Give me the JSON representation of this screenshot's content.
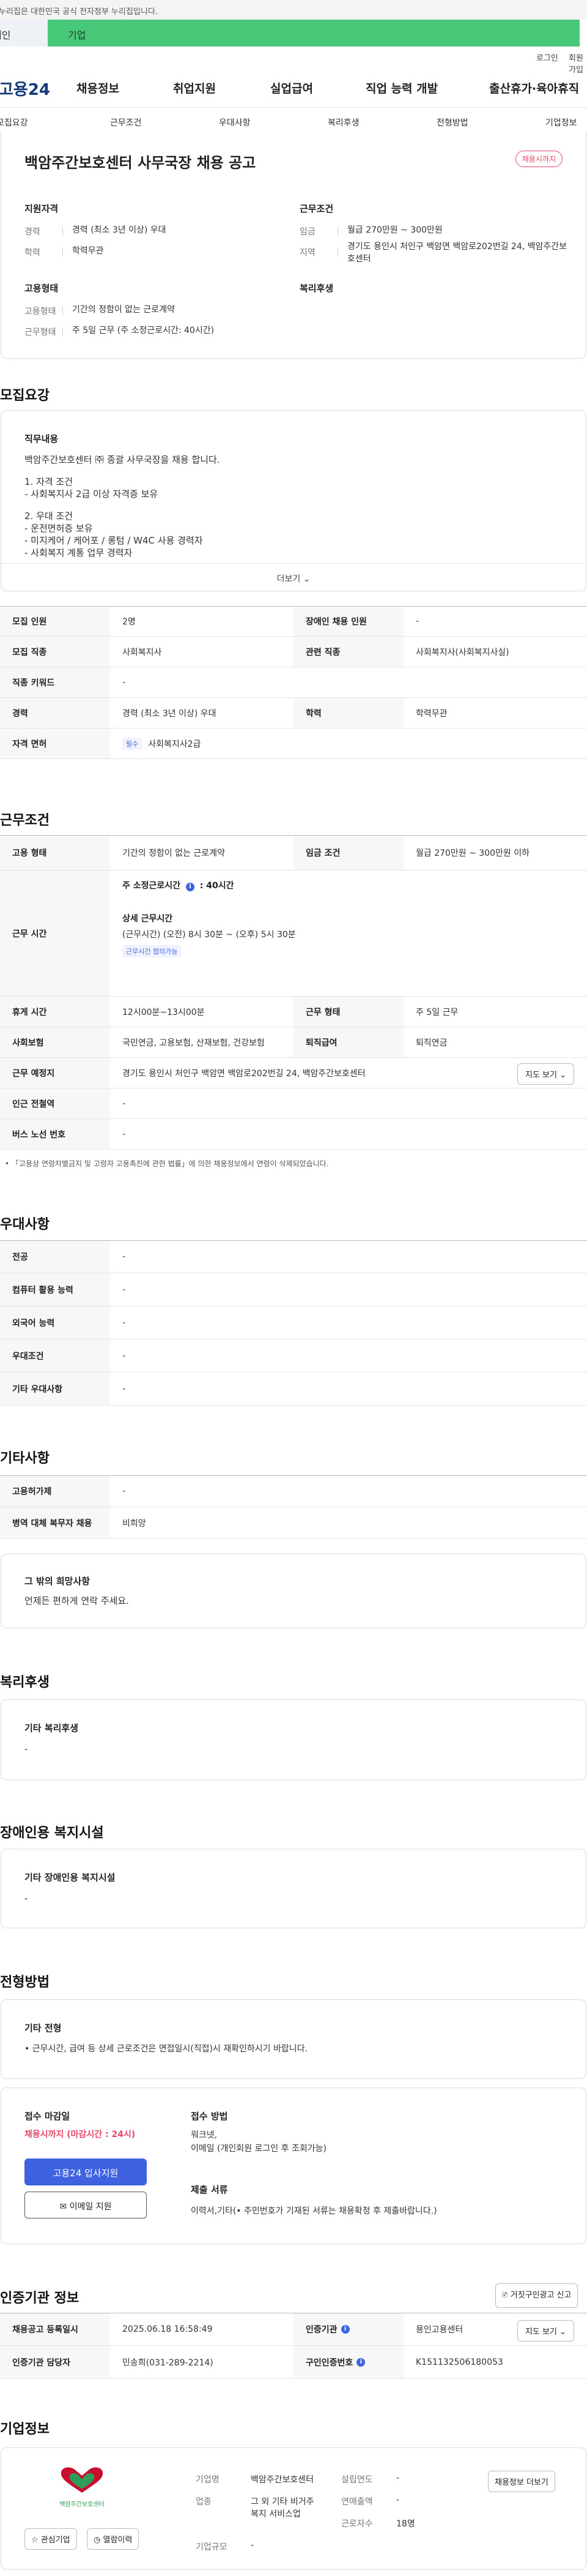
{
  "header": {
    "gov_banner": "이 누리집은 대한민국 공식 전자정부 누리집입니다.",
    "user_tabs": [
      "개인",
      "기업"
    ],
    "util_links": [
      "로그인",
      "회원가입"
    ],
    "logo": "고용24",
    "nav": [
      "채용정보",
      "취업지원",
      "실업급여",
      "직업 능력 개발",
      "출산휴가·육아휴직"
    ],
    "anchors": [
      "모집요강",
      "근무조건",
      "우대사항",
      "복리후생",
      "전형방법",
      "기업정보"
    ]
  },
  "summary": {
    "title": "백암주간보호센터 사무국장 채용 공고",
    "status": "채용시까지",
    "qual_heading": "지원자격",
    "qual": [
      {
        "k": "경력",
        "v": "경력 (최소 3년 이상) 우대"
      },
      {
        "k": "학력",
        "v": "학력무관"
      }
    ],
    "cond_heading": "근무조건",
    "cond": [
      {
        "k": "임금",
        "v": "월급 270만원 ~ 300만원"
      },
      {
        "k": "지역",
        "v": "경기도 용인시 처인구 백암면 백암로202번길 24, 백암주간보호센터"
      }
    ],
    "emp_heading": "고용형태",
    "emp": [
      {
        "k": "고용형태",
        "v": "기간의 정함이 없는 근로계약"
      },
      {
        "k": "근무형태",
        "v": "주 5일 근무 (주 소정근로시간: 40시간)"
      }
    ],
    "welfare_heading": "복리후생"
  },
  "recruit": {
    "section_title": "모집요강",
    "duty_heading": "직무내용",
    "duty_lines": [
      "백암주간보호센터 ㈜ 종괄 사무국장을 채용 합니다.",
      "1. 자격 조건",
      "- 사회복지사 2급 이상 자격증 보유",
      "2. 우대 조건",
      "- 운전면허증 보유",
      "- 미지케어 / 케어포 / 롱텀 / W4C 사용 경력자",
      "- 사회복지 계통 업무 경력자"
    ],
    "more": "더보기",
    "rows": [
      {
        "k1": "모집 인원",
        "v1": "2명",
        "k2": "장애인 채용 인원",
        "v2": "-"
      },
      {
        "k1": "모집 직종",
        "v1": "사회복지사",
        "k2": "관련 직종",
        "v2": "사회복지사(사회복지사실)"
      },
      {
        "k1": "직종 키워드",
        "v1": "-"
      },
      {
        "k1": "경력",
        "v1": "경력 (최소 3년 이상) 우대",
        "k2": "학력",
        "v2": "학력무관"
      },
      {
        "k1": "자격 면허",
        "tag": "필수",
        "v1": "사회복지사2급"
      }
    ]
  },
  "conditions": {
    "section_title": "근무조건",
    "emp_type_k": "고용 형태",
    "emp_type_v": "기간의 정함이 없는 근로계약",
    "wage_k": "임금 조건",
    "wage_v": "월급 270만원 ~ 300만원 이하",
    "hours_k": "근무 시간",
    "hours_weekly": "주 소정근로시간",
    "hours_weekly_v": "40시간",
    "hours_detail_h": "상세 근무시간",
    "hours_detail_v": "(근무시간) (오전) 8시 30분 ~ (오후) 5시 30분",
    "hours_tag": "근무시간 협의가능",
    "break_k": "휴게 시간",
    "break_v": "12시00분~13시00분",
    "shift_k": "근무 형태",
    "shift_v": "주 5일 근무",
    "insurance_k": "사회보험",
    "insurance_v": "국민연금, 고용보험, 산재보험, 건강보험",
    "severance_k": "퇴직급여",
    "severance_v": "퇴직연금",
    "place_k": "근무 예정지",
    "place_v": "경기도 용인시 처인구 백암면 백암로202번길 24, 백암주간보호센터",
    "map_btn": "지도 보기",
    "subway_k": "인근 전철역",
    "subway_v": "-",
    "bus_k": "버스 노선 번호",
    "bus_v": "-",
    "note": "「고용상 연령차별금지 및 고령자 고용촉진에 관한 법률」에 의한 채용정보에서 연령이 삭제되었습니다."
  },
  "preferences": {
    "section_title": "우대사항",
    "rows": [
      {
        "k": "전공",
        "v": "-"
      },
      {
        "k": "컴퓨터 활용 능력",
        "v": "-"
      },
      {
        "k": "외국어 능력",
        "v": "-"
      },
      {
        "k": "우대조건",
        "v": "-"
      },
      {
        "k": "기타 우대사항",
        "v": "-"
      }
    ]
  },
  "other": {
    "section_title": "기타사항",
    "rows": [
      {
        "k": "고용허가제",
        "v": "-"
      },
      {
        "k": "병역 대체 복무자 채용",
        "v": "비희망"
      }
    ],
    "wish_h": "그 밖의 희망사항",
    "wish_v": "언제든 편하게 연락 주세요."
  },
  "welfare": {
    "section_title": "복리후생",
    "h": "기타 복리후생",
    "v": "-"
  },
  "disabled": {
    "section_title": "장애인용 복지시설",
    "h": "기타 장애인용 복지시설",
    "v": "-"
  },
  "selection": {
    "section_title": "전형방법",
    "h": "기타 전형",
    "v": "• 근무시간, 급여 등 상세 근로조건은 면접일시(직접)시 재확인하시기 바랍니다.",
    "deadline_h": "접수 마감일",
    "deadline_v": "채용시까지 (마감시간 : 24시)",
    "apply_btn": "고용24 입사지원",
    "email_btn": "이메일 지원",
    "method_h": "접수 방법",
    "method_v1": "워크넷,",
    "method_v2": "이메일 (개인회원 로그인 후 조회가능)",
    "docs_h": "제출 서류",
    "docs_v": "이력서,기타(• 주민번호가 기재된 서류는 채용확정 후 제출바랍니다.)"
  },
  "agency": {
    "section_title": "인증기관 정보",
    "report_btn": "거짓구인광고 신고",
    "rows": [
      {
        "k1": "채용공고 등록일시",
        "v1": "2025.06.18 16:58:49",
        "k2": "인증기관",
        "v2": "용인고용센터"
      },
      {
        "k1": "인증기관 담당자",
        "v1": "민송희(031-289-2214)",
        "k2": "구인인증번호",
        "v2": "K151132506180053"
      }
    ],
    "map_btn": "지도 보기"
  },
  "company": {
    "section_title": "기업정보",
    "logo_text": "백암주간보호센터",
    "fav_btn": "관심기업",
    "bookmark_btn": "열람이력",
    "name_k": "기업명",
    "name_v": "백암주간보호센터",
    "year_k": "설립연도",
    "year_v": "-",
    "industry_k": "업종",
    "industry_v1": "그 외 기타 비거주",
    "industry_v2": "복지 서비스업",
    "sales_k": "연매출액",
    "sales_v": "-",
    "emp_k": "근로자수",
    "emp_v": "18명",
    "scale_k": "기업규모",
    "scale_v": "-",
    "jobs_btn": "채용정보 더보기"
  }
}
